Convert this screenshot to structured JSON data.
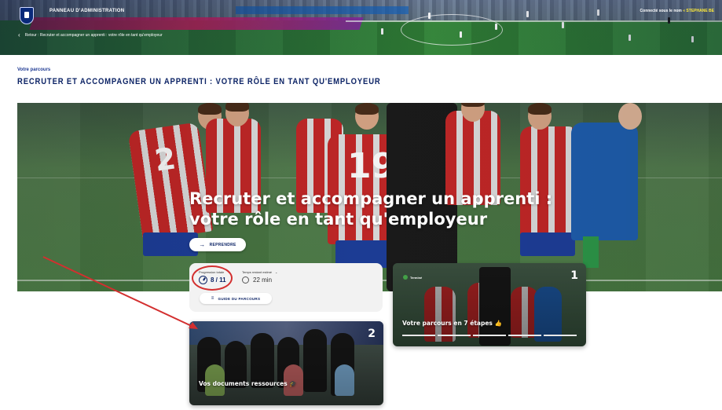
{
  "header": {
    "admin_title": "PANNEAU D'ADMINISTRATION",
    "connected_prefix": "Connecté sous le nom",
    "connected_user": "« STEPHANE BE",
    "breadcrumb": "Retour : Recruter et accompagner un apprenti : votre rôle en tant qu'employeur"
  },
  "page": {
    "section_label": "Votre parcours",
    "title": "RECRUTER ET ACCOMPAGNER UN APPRENTI : VOTRE RÔLE EN TANT QU'EMPLOYEUR"
  },
  "hero": {
    "title": "Recruter et accompagner un apprenti : votre rôle en tant qu'employeur",
    "resume_label": "REPRENDRE",
    "jersey_numbers": [
      "2",
      "19"
    ]
  },
  "progress": {
    "label": "Progression totale",
    "value": "8 / 11",
    "time_label": "Temps restant estimé",
    "time_value": "22 min",
    "guide_label": "GUIDE DU PARCOURS"
  },
  "cards": [
    {
      "number": "1",
      "status": "Terminé",
      "title": "Votre parcours en 7 étapes 👍"
    },
    {
      "number": "2",
      "title": "Vos documents ressources 🎓"
    }
  ],
  "colors": {
    "brand_navy": "#0d2466",
    "accent_red": "#d32f2f",
    "complete_green": "#43a047"
  }
}
